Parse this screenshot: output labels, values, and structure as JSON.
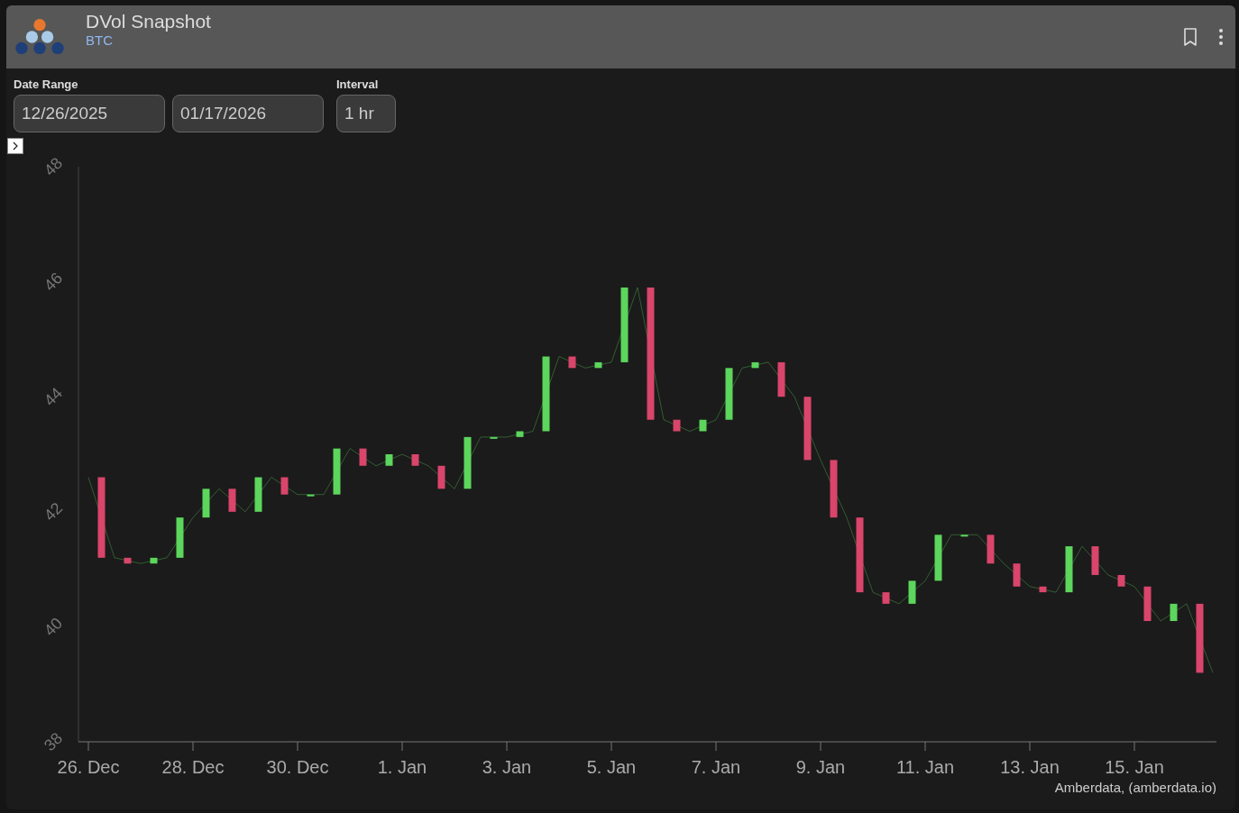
{
  "header": {
    "title": "DVol Snapshot",
    "subtitle": "BTC"
  },
  "filters": {
    "date_range_label": "Date Range",
    "start_date": "12/26/2025",
    "end_date": "01/17/2026",
    "interval_label": "Interval",
    "interval": "1 hr"
  },
  "chart": {
    "credits": "Amberdata, (amberdata.io)",
    "chart_data": {
      "type": "line",
      "categories": [
        "26. Dec",
        null,
        null,
        null,
        "28. Dec",
        null,
        null,
        null,
        "30. Dec",
        null,
        null,
        null,
        "1. Jan",
        null,
        null,
        null,
        "3. Jan",
        null,
        null,
        null,
        "5. Jan",
        null,
        null,
        null,
        "7. Jan",
        null,
        null,
        null,
        "9. Jan",
        null,
        null,
        null,
        "11. Jan",
        null,
        null,
        null,
        "13. Jan",
        null,
        null,
        null,
        "15. Jan",
        null,
        null,
        null
      ],
      "series": [
        {
          "color": "#5cd65c",
          "values": [
            42.6,
            41.2,
            41.1,
            41.2,
            41.9,
            42.4,
            42.0,
            42.6,
            42.3,
            42.3,
            43.1,
            42.8,
            43.0,
            42.8,
            42.4,
            43.3,
            43.3,
            43.4,
            44.7,
            44.5,
            44.6,
            45.9,
            43.6,
            43.4,
            43.6,
            44.5,
            44.6,
            44.0,
            42.9,
            41.9,
            40.6,
            40.4,
            40.8,
            41.6,
            41.6,
            41.1,
            40.7,
            40.6,
            41.4,
            40.9,
            40.7,
            40.1,
            40.4,
            39.2
          ]
        }
      ],
      "ylim": [
        38,
        48
      ],
      "yticks": [
        38,
        40,
        42,
        44,
        46,
        48
      ]
    }
  }
}
